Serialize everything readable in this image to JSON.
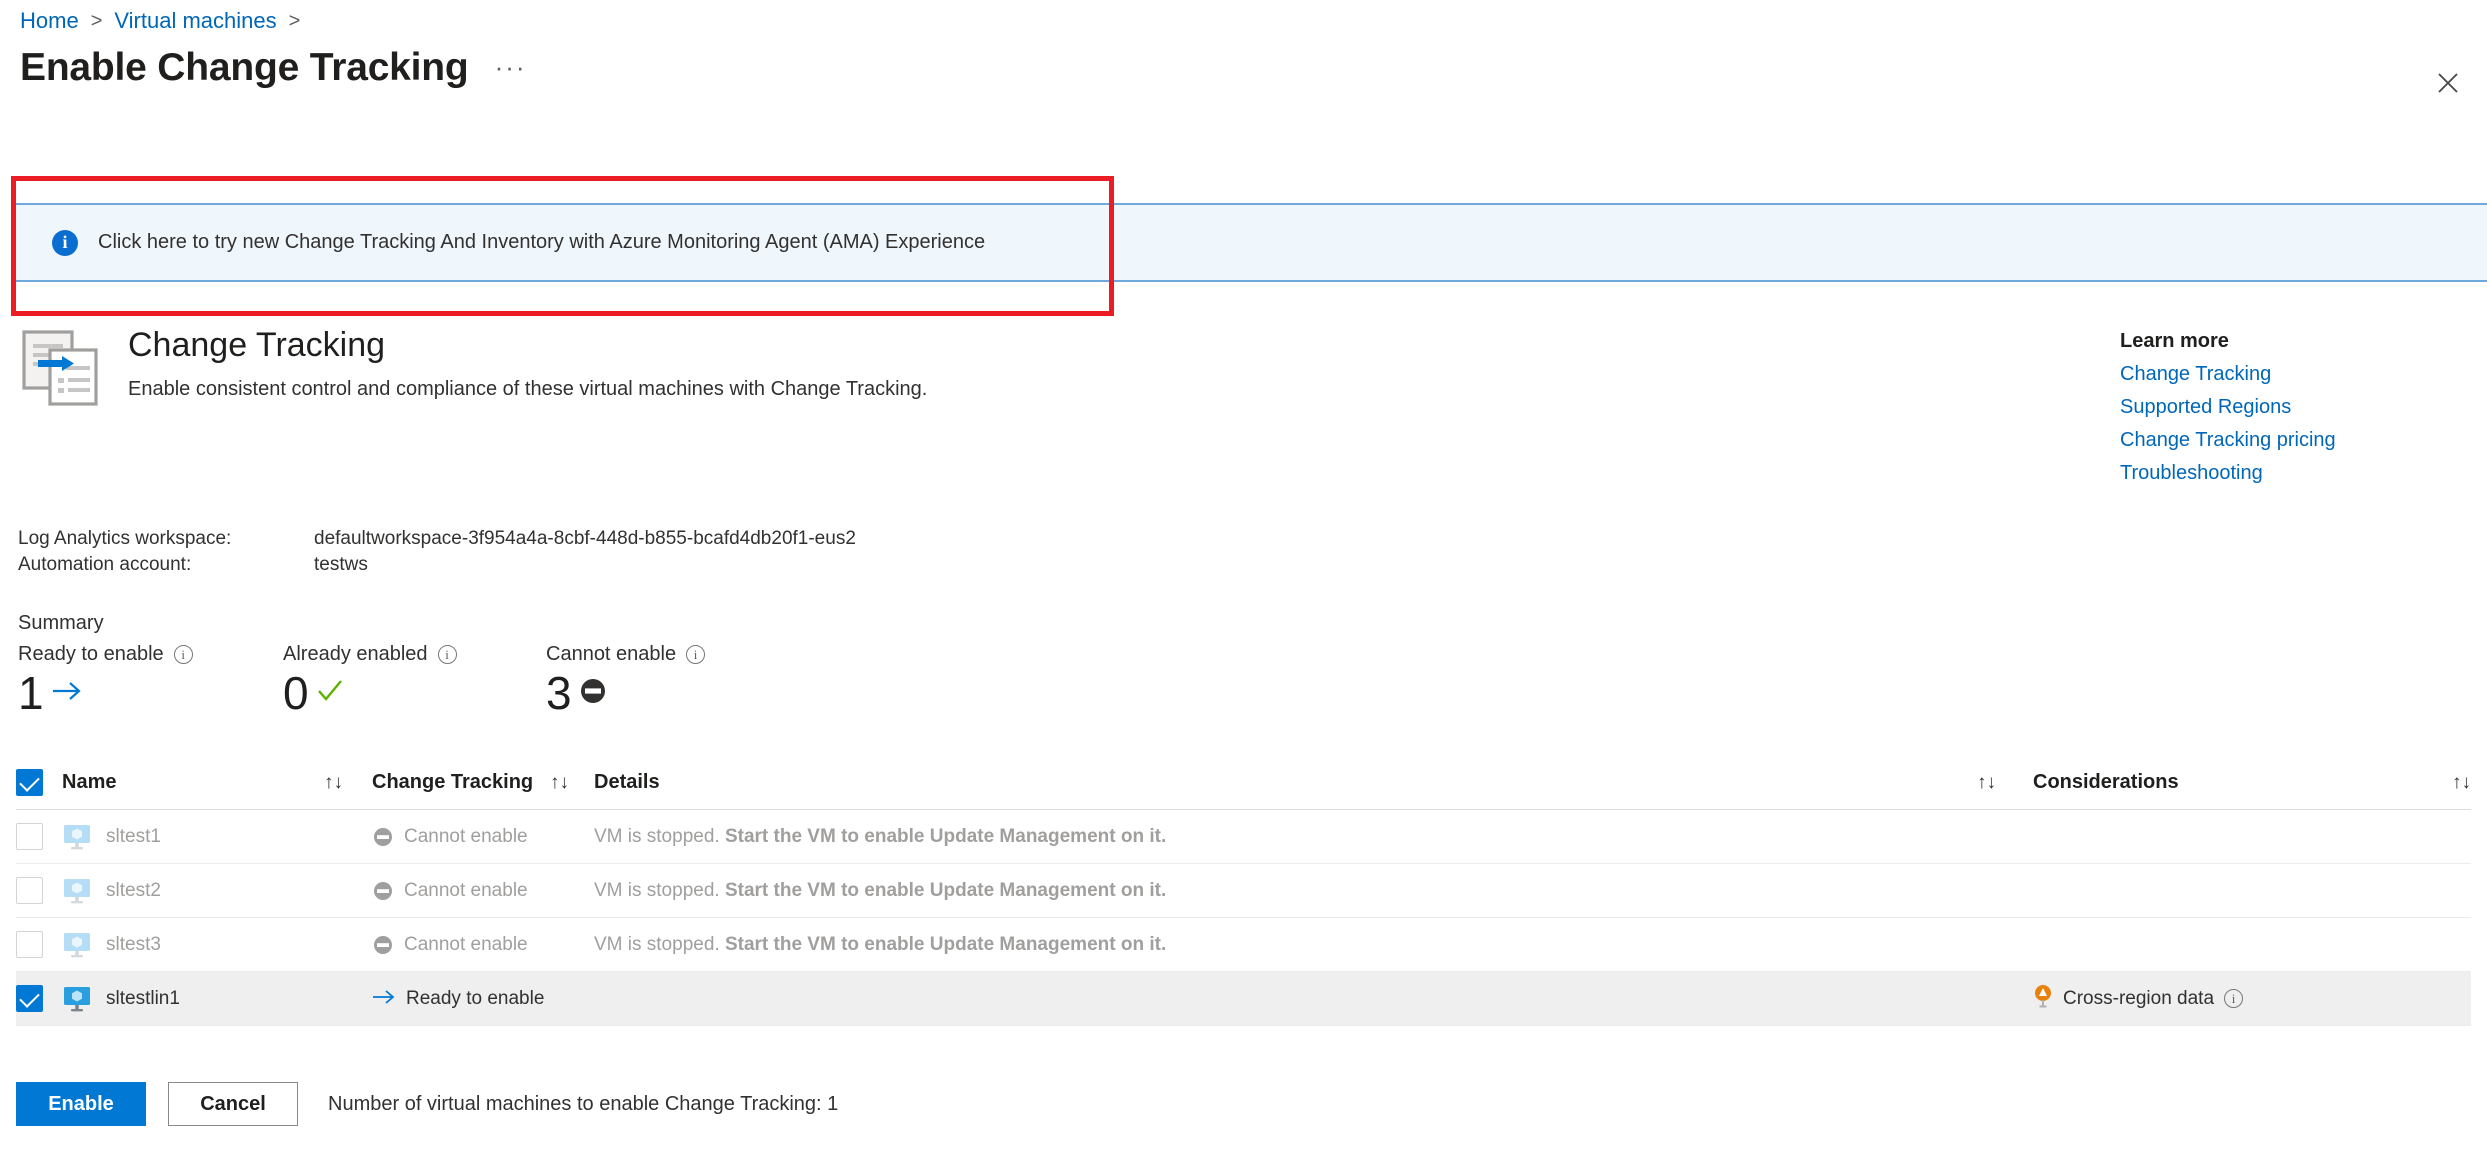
{
  "breadcrumb": {
    "items": [
      {
        "label": "Home"
      },
      {
        "label": "Virtual machines"
      }
    ],
    "separator": ">"
  },
  "header": {
    "title": "Enable Change Tracking",
    "more_label": "···",
    "close_icon": "close-icon"
  },
  "banner": {
    "icon": "info-icon",
    "text": "Click here to try new Change Tracking And Inventory with Azure Monitoring Agent (AMA) Experience",
    "highlight_color": "#ec1c24",
    "background_color": "#eff6fc",
    "border_color": "#6fa8dc"
  },
  "hero": {
    "icon": "change-tracking-icon",
    "title": "Change Tracking",
    "subtitle": "Enable consistent control and compliance of these virtual machines with Change Tracking."
  },
  "learn_more": {
    "title": "Learn more",
    "links": [
      {
        "label": "Change Tracking"
      },
      {
        "label": "Supported Regions"
      },
      {
        "label": "Change Tracking pricing"
      },
      {
        "label": "Troubleshooting"
      }
    ],
    "link_color": "#0067b8"
  },
  "meta": {
    "workspace_label": "Log Analytics workspace:",
    "workspace_value": "defaultworkspace-3f954a4a-8cbf-448d-b855-bcafd4db20f1-eus2",
    "automation_label": "Automation account:",
    "automation_value": "testws"
  },
  "summary": {
    "title": "Summary",
    "stats": [
      {
        "label": "Ready to enable",
        "value": "1",
        "icon": "arrow-right-icon",
        "color": "#0078d4"
      },
      {
        "label": "Already enabled",
        "value": "0",
        "icon": "checkmark-icon",
        "color": "#5bb300"
      },
      {
        "label": "Cannot enable",
        "value": "3",
        "icon": "blocked-icon",
        "color": "#323130"
      }
    ],
    "info_glyph": "i"
  },
  "table": {
    "columns": {
      "name": "Name",
      "change_tracking": "Change Tracking",
      "details": "Details",
      "considerations": "Considerations"
    },
    "sort_glyph": "↑↓",
    "header_checked": true,
    "rows": [
      {
        "name": "sltest1",
        "checked": false,
        "enabled": false,
        "status": "Cannot enable",
        "status_icon": "blocked-icon",
        "details_normal": "VM is stopped.",
        "details_strong": "Start the VM to enable Update Management on it.",
        "consideration": ""
      },
      {
        "name": "sltest2",
        "checked": false,
        "enabled": false,
        "status": "Cannot enable",
        "status_icon": "blocked-icon",
        "details_normal": "VM is stopped.",
        "details_strong": "Start the VM to enable Update Management on it.",
        "consideration": ""
      },
      {
        "name": "sltest3",
        "checked": false,
        "enabled": false,
        "status": "Cannot enable",
        "status_icon": "blocked-icon",
        "details_normal": "VM is stopped.",
        "details_strong": "Start the VM to enable Update Management on it.",
        "consideration": ""
      },
      {
        "name": "sltestlin1",
        "checked": true,
        "enabled": true,
        "status": "Ready to enable",
        "status_icon": "arrow-right-icon",
        "details_normal": "",
        "details_strong": "",
        "consideration": "Cross-region data"
      }
    ]
  },
  "footer": {
    "enable_label": "Enable",
    "cancel_label": "Cancel",
    "note": "Number of virtual machines to enable Change Tracking: 1"
  }
}
